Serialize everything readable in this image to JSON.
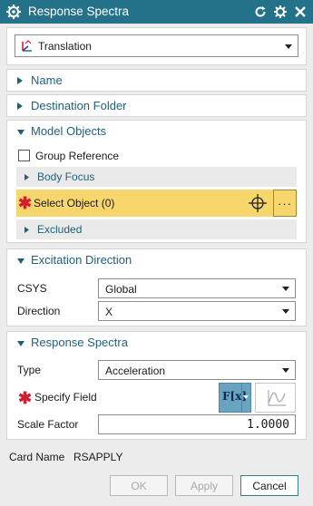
{
  "window": {
    "title": "Response Spectra"
  },
  "type_combo": {
    "value": "Translation"
  },
  "sections": {
    "name": "Name",
    "destination_folder": "Destination Folder",
    "model_objects": "Model Objects",
    "excitation_direction": "Excitation Direction",
    "response_spectra": "Response Spectra"
  },
  "model_objects": {
    "group_reference_label": "Group Reference",
    "group_reference_checked": false,
    "body_focus": "Body Focus",
    "select_object": "Select Object (0)",
    "dots": "···",
    "excluded": "Excluded"
  },
  "excitation": {
    "csys_label": "CSYS",
    "csys_value": "Global",
    "direction_label": "Direction",
    "direction_value": "X"
  },
  "response": {
    "type_label": "Type",
    "type_value": "Acceleration",
    "specify_field_label": "Specify Field",
    "fx_label": "F[x]",
    "scale_factor_label": "Scale Factor",
    "scale_factor_value": "1.0000"
  },
  "card": {
    "label": "Card Name",
    "value": "RSAPPLY"
  },
  "buttons": {
    "ok": "OK",
    "apply": "Apply",
    "cancel": "Cancel"
  },
  "colors": {
    "titlebar": "#237289",
    "section_text": "#1f5f7a",
    "highlight": "#f7d66e",
    "required": "#d0202f"
  }
}
